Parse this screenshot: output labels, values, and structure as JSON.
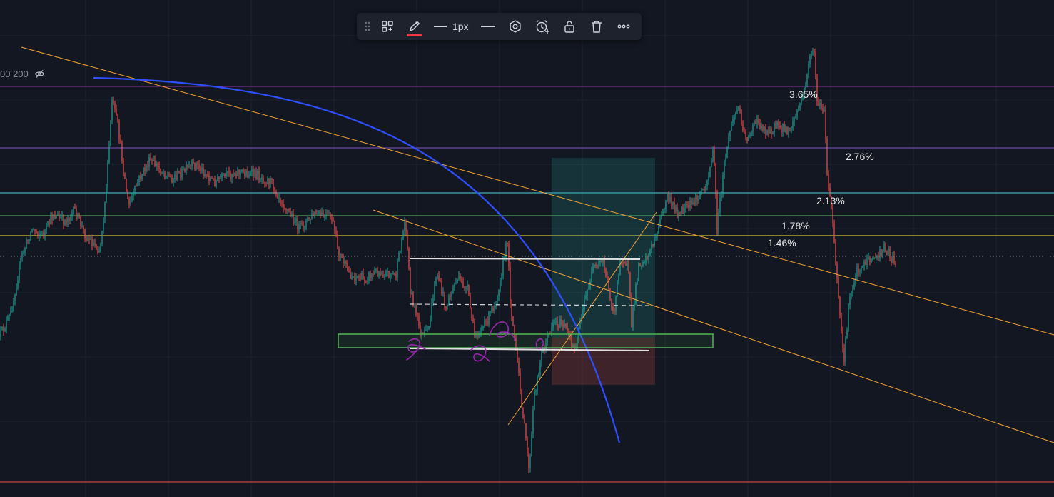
{
  "colors": {
    "background": "#131722",
    "grid": "#1f2330",
    "candle_up": "#26a69a",
    "candle_down": "#ef5350",
    "trendline": "#f7a531",
    "arc": "#2e4fff",
    "support_box": "#4caf50",
    "position_profit": "#26a69a",
    "position_loss": "#ef5350",
    "purple_line": "#9c27b0",
    "violet_line": "#7e57c2",
    "cyan_line": "#4dd0e1",
    "green_line": "#66bb6a",
    "yellow_line": "#ffeb3b",
    "red_line": "#ef5350",
    "swatch": "#f23645",
    "marker": "#9c27b0"
  },
  "legend": {
    "ma_text": "00 200",
    "eye_icon": "eye-crossed-icon"
  },
  "percent_labels": [
    "3.65%",
    "2.76%",
    "2.13%",
    "1.78%",
    "1.46%"
  ],
  "toolbar": {
    "width_label": "1px",
    "icons": [
      "drag-handle-icon",
      "templates-icon",
      "pencil-icon",
      "line-width-icon",
      "line-style-icon",
      "settings-icon",
      "alert-icon",
      "lock-icon",
      "trash-icon",
      "more-icon"
    ]
  }
}
